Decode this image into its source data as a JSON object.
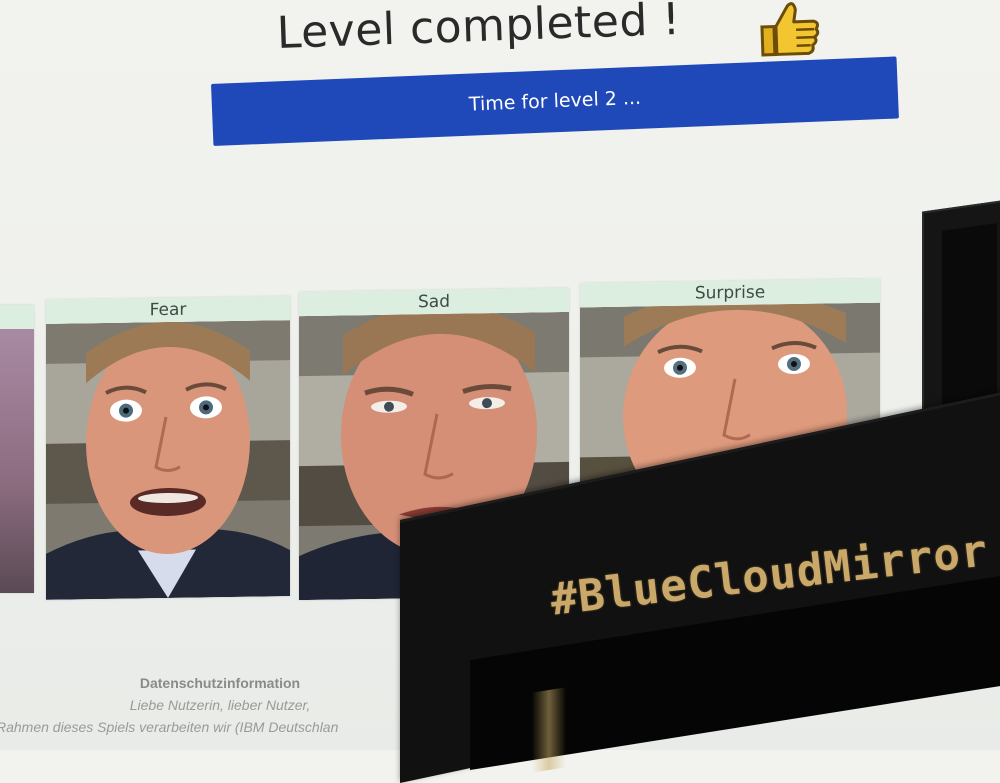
{
  "header": {
    "title": "Level completed !",
    "icon": "thumbs-up-icon"
  },
  "level_button": {
    "label": "Time for level 2 ..."
  },
  "emotion_cards": [
    {
      "label": "Fear"
    },
    {
      "label": "Sad"
    },
    {
      "label": "Surprise"
    }
  ],
  "privacy": {
    "title": "Datenschutzinformation",
    "greeting": "Liebe Nutzerin, lieber Nutzer,",
    "text": "Rahmen dieses Spiels verarbeiten wir (IBM Deutschlan"
  },
  "device": {
    "hashtag": "#BlueCloudMirror"
  },
  "colors": {
    "button_blue": "#1f49b8",
    "label_green": "#dceee0",
    "hashtag_gold": "#c9a86a"
  }
}
